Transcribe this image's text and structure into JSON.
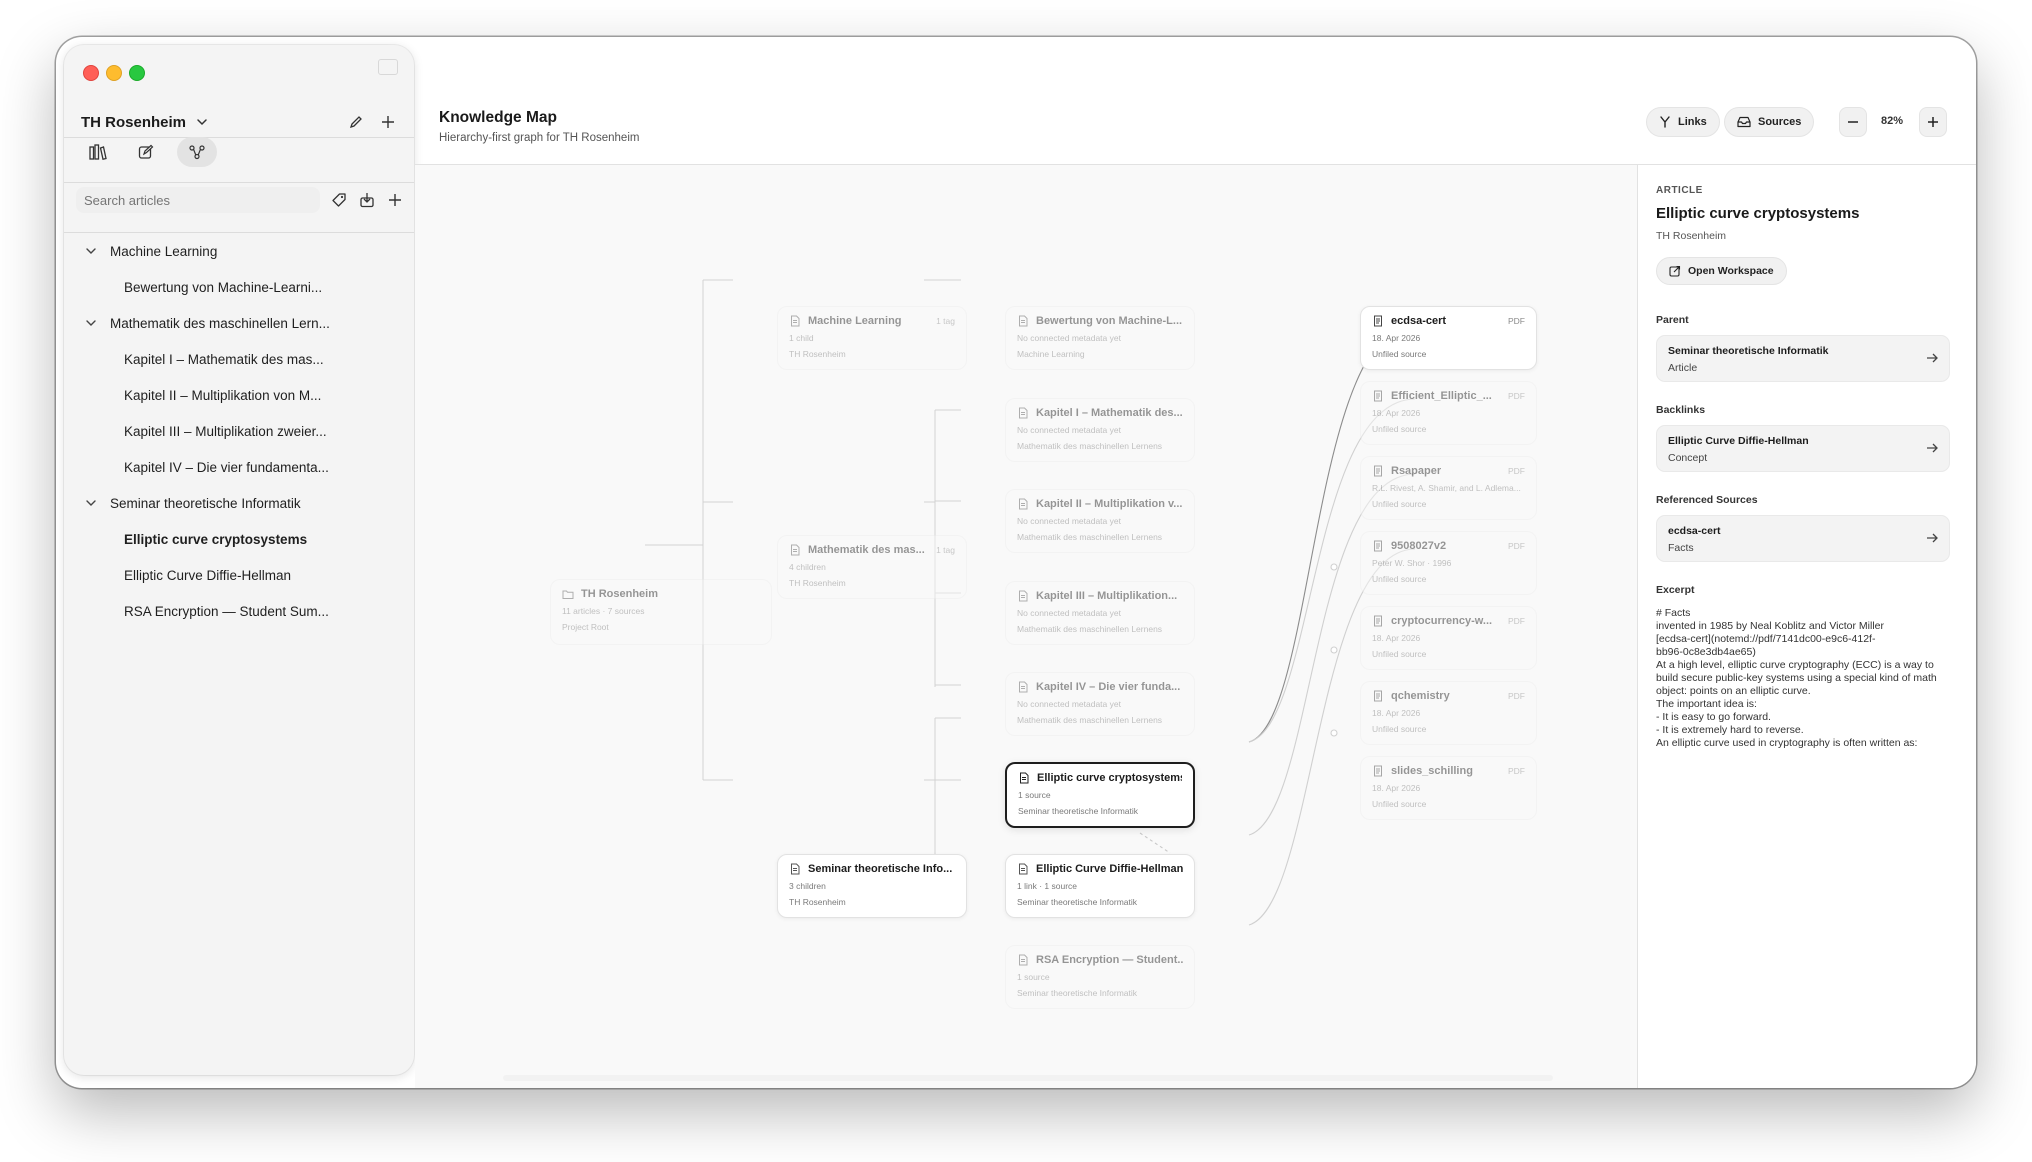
{
  "window": {
    "workspace": "TH Rosenheim"
  },
  "sidebar": {
    "search_placeholder": "Search articles",
    "tree": [
      {
        "label": "Machine Learning",
        "level": 0,
        "expanded": true
      },
      {
        "label": "Bewertung von Machine-Learni...",
        "level": 1
      },
      {
        "label": "Mathematik des maschinellen Lern...",
        "level": 0,
        "expanded": true
      },
      {
        "label": "Kapitel I – Mathematik des mas...",
        "level": 1
      },
      {
        "label": "Kapitel II – Multiplikation von M...",
        "level": 1
      },
      {
        "label": "Kapitel III – Multiplikation zweier...",
        "level": 1
      },
      {
        "label": "Kapitel IV – Die vier fundamenta...",
        "level": 1
      },
      {
        "label": "Seminar theoretische Informatik",
        "level": 0,
        "expanded": true
      },
      {
        "label": "Elliptic curve cryptosystems",
        "level": 1,
        "selected": true
      },
      {
        "label": "Elliptic Curve Diffie-Hellman",
        "level": 1
      },
      {
        "label": "RSA Encryption — Student Sum...",
        "level": 1
      }
    ]
  },
  "header": {
    "title": "Knowledge Map",
    "subtitle": "Hierarchy-first graph for TH Rosenheim",
    "links_label": "Links",
    "sources_label": "Sources",
    "zoom": "82%"
  },
  "graph": {
    "root": {
      "title": "TH Rosenheim",
      "meta": "11 articles · 7 sources",
      "meta2": "Project Root"
    },
    "topics": [
      {
        "title": "Machine Learning",
        "badge": "1 tag",
        "meta": "1 child",
        "meta2": "TH Rosenheim"
      },
      {
        "title": "Mathematik des mas...",
        "badge": "1 tag",
        "meta": "4 children",
        "meta2": "TH Rosenheim"
      },
      {
        "title": "Seminar theoretische Info...",
        "badge": "",
        "meta": "3 children",
        "meta2": "TH Rosenheim"
      }
    ],
    "articles": [
      {
        "title": "Bewertung von Machine-L...",
        "meta": "No connected metadata yet",
        "meta2": "Machine Learning"
      },
      {
        "title": "Kapitel I – Mathematik des...",
        "meta": "No connected metadata yet",
        "meta2": "Mathematik des maschinellen Lernens"
      },
      {
        "title": "Kapitel II – Multiplikation v...",
        "meta": "No connected metadata yet",
        "meta2": "Mathematik des maschinellen Lernens"
      },
      {
        "title": "Kapitel III – Multiplikation...",
        "meta": "No connected metadata yet",
        "meta2": "Mathematik des maschinellen Lernens"
      },
      {
        "title": "Kapitel IV – Die vier funda...",
        "meta": "No connected metadata yet",
        "meta2": "Mathematik des maschinellen Lernens"
      },
      {
        "title": "Elliptic curve cryptosystems",
        "meta": "1 source",
        "meta2": "Seminar theoretische Informatik"
      },
      {
        "title": "Elliptic Curve Diffie-Hellman",
        "meta": "1 link · 1 source",
        "meta2": "Seminar theoretische Informatik"
      },
      {
        "title": "RSA Encryption — Student...",
        "meta": "1 source",
        "meta2": "Seminar theoretische Informatik"
      }
    ],
    "sources": [
      {
        "title": "ecdsa-cert",
        "badge": "PDF",
        "meta": "18. Apr 2026",
        "meta2": "Unfiled source"
      },
      {
        "title": "Efficient_Elliptic_...",
        "badge": "PDF",
        "meta": "18. Apr 2026",
        "meta2": "Unfiled source"
      },
      {
        "title": "Rsapaper",
        "badge": "PDF",
        "meta": "R.L. Rivest, A. Shamir, and L. Adlema...",
        "meta2": "Unfiled source"
      },
      {
        "title": "9508027v2",
        "badge": "PDF",
        "meta": "Peter W. Shor · 1996",
        "meta2": "Unfiled source"
      },
      {
        "title": "cryptocurrency-w...",
        "badge": "PDF",
        "meta": "18. Apr 2026",
        "meta2": "Unfiled source"
      },
      {
        "title": "qchemistry",
        "badge": "PDF",
        "meta": "18. Apr 2026",
        "meta2": "Unfiled source"
      },
      {
        "title": "slides_schilling",
        "badge": "PDF",
        "meta": "18. Apr 2026",
        "meta2": "Unfiled source"
      }
    ]
  },
  "inspector": {
    "kicker": "ARTICLE",
    "title": "Elliptic curve cryptosystems",
    "project": "TH Rosenheim",
    "open_label": "Open Workspace",
    "parent_label": "Parent",
    "parent": {
      "title": "Seminar theoretische Informatik",
      "sub": "Article"
    },
    "backlinks_label": "Backlinks",
    "backlink": {
      "title": "Elliptic Curve Diffie-Hellman",
      "sub": "Concept"
    },
    "sources_label": "Referenced Sources",
    "source": {
      "title": "ecdsa-cert",
      "sub": "Facts"
    },
    "excerpt_label": "Excerpt",
    "excerpt_lines": [
      "# Facts",
      "invented in 1985 by Neal Koblitz and Victor Miller",
      "[ecdsa-cert](notemd://pdf/7141dc00-e9c6-412f-",
      "bb96-0c8e3db4ae65)",
      "At a high level, elliptic curve cryptography (ECC) is a way to",
      "build secure public-key systems using a special kind of math",
      "object: points on an elliptic curve.",
      "The important idea is:",
      "- It is easy to go forward.",
      "- It is extremely hard to reverse.",
      "An elliptic curve used in cryptography is often written as:"
    ]
  },
  "colors": {
    "selected_border": "#1e1e1e",
    "canvas_bg": "#f9f9f9",
    "edge": "#c9c9c9",
    "source_edge": "#8c8c8c"
  }
}
